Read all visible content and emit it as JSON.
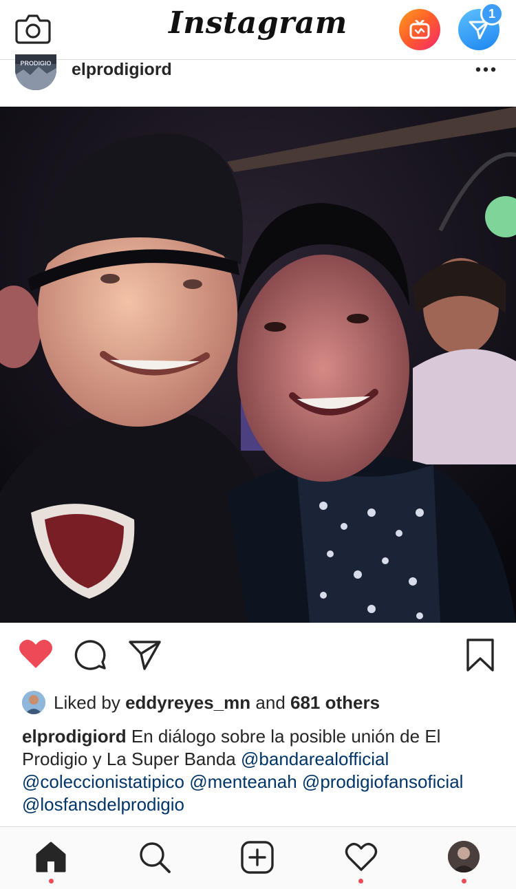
{
  "top_bar": {
    "logo": "Instagram",
    "badge_count": "1",
    "icons": [
      "camera-icon",
      "igtv-icon",
      "direct-message-icon"
    ],
    "igtv_gradient": [
      "#ff9a1f",
      "#f6276f"
    ],
    "direct_gradient": [
      "#5cc0ff",
      "#1e86f0"
    ]
  },
  "post": {
    "username": "elprodigiord",
    "avatar_text": "PRODIGIO",
    "more_icon": "more-options-icon"
  },
  "actions": {
    "liked": true,
    "like_color": "#ed4956",
    "icons": [
      "heart-icon",
      "comment-icon",
      "share-icon",
      "bookmark-icon"
    ]
  },
  "likes": {
    "prefix": "Liked by ",
    "user": "eddyreyes_mn",
    "middle": " and ",
    "count": "681 others"
  },
  "caption": {
    "user": "elprodigiord",
    "text": " En diálogo sobre la posible unión de El Prodigio y La Super Banda ",
    "mentions": [
      "@bandarealofficial",
      "@coleccionistatipico",
      "@menteanah",
      "@prodigiofansoficial",
      "@losfansdelprodigio"
    ],
    "mention_color": "#003569"
  },
  "tab_bar": {
    "tabs": [
      "home-icon",
      "search-icon",
      "new-post-icon",
      "activity-icon",
      "profile-avatar"
    ],
    "notification_dot_color": "#ed4956"
  }
}
